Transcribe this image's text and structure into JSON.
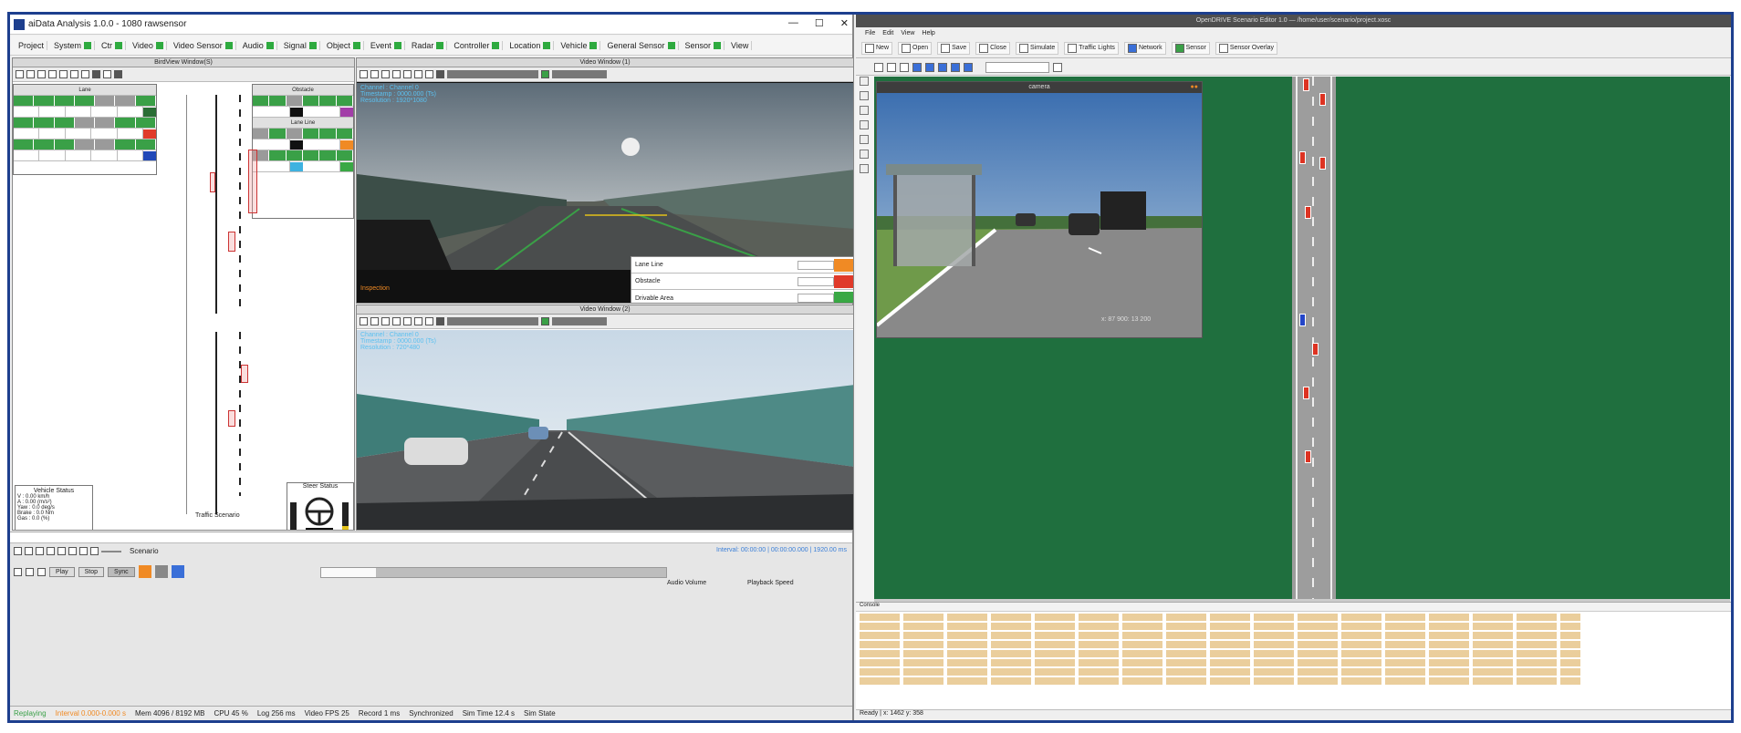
{
  "left_app": {
    "title": "aiData Analysis 1.0.0 - 1080 rawsensor",
    "window_controls": [
      "—",
      "☐",
      "✕"
    ],
    "menu": [
      "Project",
      "System",
      "Ctr",
      "Video",
      "Video Sensor",
      "Audio",
      "Signal",
      "Object",
      "Event",
      "Radar",
      "Controller",
      "Location",
      "Vehicle",
      "General Sensor",
      "Sensor",
      "View"
    ],
    "panels": {
      "bird_view_title": "BirdView Window(S)",
      "video_top_title": "Video Window (1)",
      "video_bottom_title": "Video Window (2)",
      "video_top_labels": [
        "Channel : Channel 0",
        "Timestamp : 0000.000 (Ts)",
        "Resolution : 1920*1080"
      ],
      "video_bottom_labels": [
        "Channel : Channel 0",
        "Timestamp : 0000.000 (Ts)",
        "Resolution : 720*480"
      ],
      "video_top_overlay": [
        "Lane Line",
        "Obstacle",
        "Drivable Area"
      ],
      "video_top_bottom_label": "Inspection",
      "legend_groups": [
        "Lane",
        "Obstacle",
        "Lane Line"
      ],
      "vehicle_status_title": "Vehicle Status",
      "vehicle_status_rows": [
        "V : 0.00 km/h",
        "A : 0.00 (m/s²)",
        "Yaw : 0.0 deg/s",
        "Brake : 0.0 Nm",
        "Gas : 0.0 (%)"
      ],
      "steering_title": "Steer Status",
      "traffic_scenario_label": "Traffic Scenario"
    },
    "bottom": {
      "mode_label": "Scenario",
      "time_info": "Interval: 00:00:00 | 00:00:00.000 | 1920.00 ms",
      "play_btn": "Play",
      "stop_btn": "Stop",
      "sync_label": "Sync",
      "audio_label": "Audio Volume",
      "playback_label": "Playback Speed",
      "status": [
        "Replaying",
        "Interval 0.000-0.000 s",
        "Mem 4096 / 8192 MB",
        "CPU 45 %",
        "Log 256 ms",
        "Video FPS 25",
        "Record 1 ms",
        "Synchronized",
        "Sim Time 12.4 s",
        "Sim State"
      ]
    }
  },
  "right_app": {
    "title": "OpenDRIVE Scenario Editor 1.0 — /home/user/scenario/project.xosc",
    "menu": [
      "File",
      "Edit",
      "View",
      "Help"
    ],
    "toolbar": [
      "New",
      "Open",
      "Save",
      "Close",
      "Simulate",
      "Traffic Lights",
      "Network",
      "Sensor",
      "Sensor Overlay"
    ],
    "subwindow_title": "camera",
    "subwindow_overlay": "x: 87 900: 13 200",
    "log_title": "Console",
    "status": "Ready | x: 1462 y: 358"
  },
  "colors": {
    "frame_border": "#1d3f8e",
    "scene_green": "#1f6f3e",
    "toolbar_green": "#2eaa3f",
    "accent_orange": "#f08a24",
    "accent_red": "#e03a2a"
  }
}
